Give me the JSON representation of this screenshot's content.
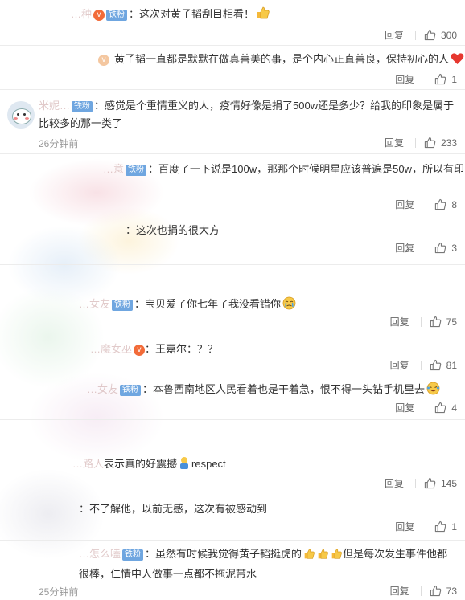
{
  "reply_label": "回复",
  "badge_label": "铁粉",
  "comments": [
    {
      "name": "…种",
      "text": "：这次对黄子韬刮目相看！",
      "emoji": "thumbs-up-emoji",
      "likes": "300"
    },
    {
      "name": "",
      "text": "黄子韬一直都是默默在做真善美的事，是个内心正直善良，保持初心的人",
      "emoji": "red-heart-emoji",
      "likes": "1"
    },
    {
      "name": "米妮…",
      "text": "：感觉是个重情重义的人，疫情好像是捐了500w还是多少？给我的印象是属于比较多的那一类了",
      "time": "26分钟前",
      "likes": "233"
    },
    {
      "name": "…意",
      "text": "：百度了一下说是100w，那那个时候明星应该普遍是50w，所以有印",
      "likes": "8"
    },
    {
      "name": "",
      "text": "：这次也捐的很大方",
      "likes": "3"
    },
    {
      "name": "…女友",
      "text": "：宝贝爱了你七年了我没看错你",
      "emoji": "cry-emoji",
      "likes": "75"
    },
    {
      "name": "…魔女巫",
      "text": "：王嘉尔：？？",
      "likes": "81"
    },
    {
      "name": "…女友",
      "text": "：本鲁西南地区人民看着也是干着急，恨不得一头钻手机里去",
      "emoji": "laugh-cry-emoji",
      "likes": "4"
    },
    {
      "name": "…路人",
      "text": "表示真的好震撼",
      "emoji": "person-emoji",
      "text2": "respect",
      "likes": "145"
    },
    {
      "name": "",
      "text": "：不了解他，以前无感，这次有被感动到",
      "likes": "1"
    },
    {
      "name": "…怎么嗑",
      "text": "：虽然有时候我觉得黄子韬挺虎的",
      "text2": "但是每次发生事件他都很棒，仁情中人做事一点都不拖泥带水",
      "time": "25分钟前",
      "likes": "73"
    }
  ],
  "colors": {
    "link": "#7c93b8",
    "badge": "#6fa6e0",
    "vip": "#f26b39",
    "heart": "#e6372f"
  }
}
